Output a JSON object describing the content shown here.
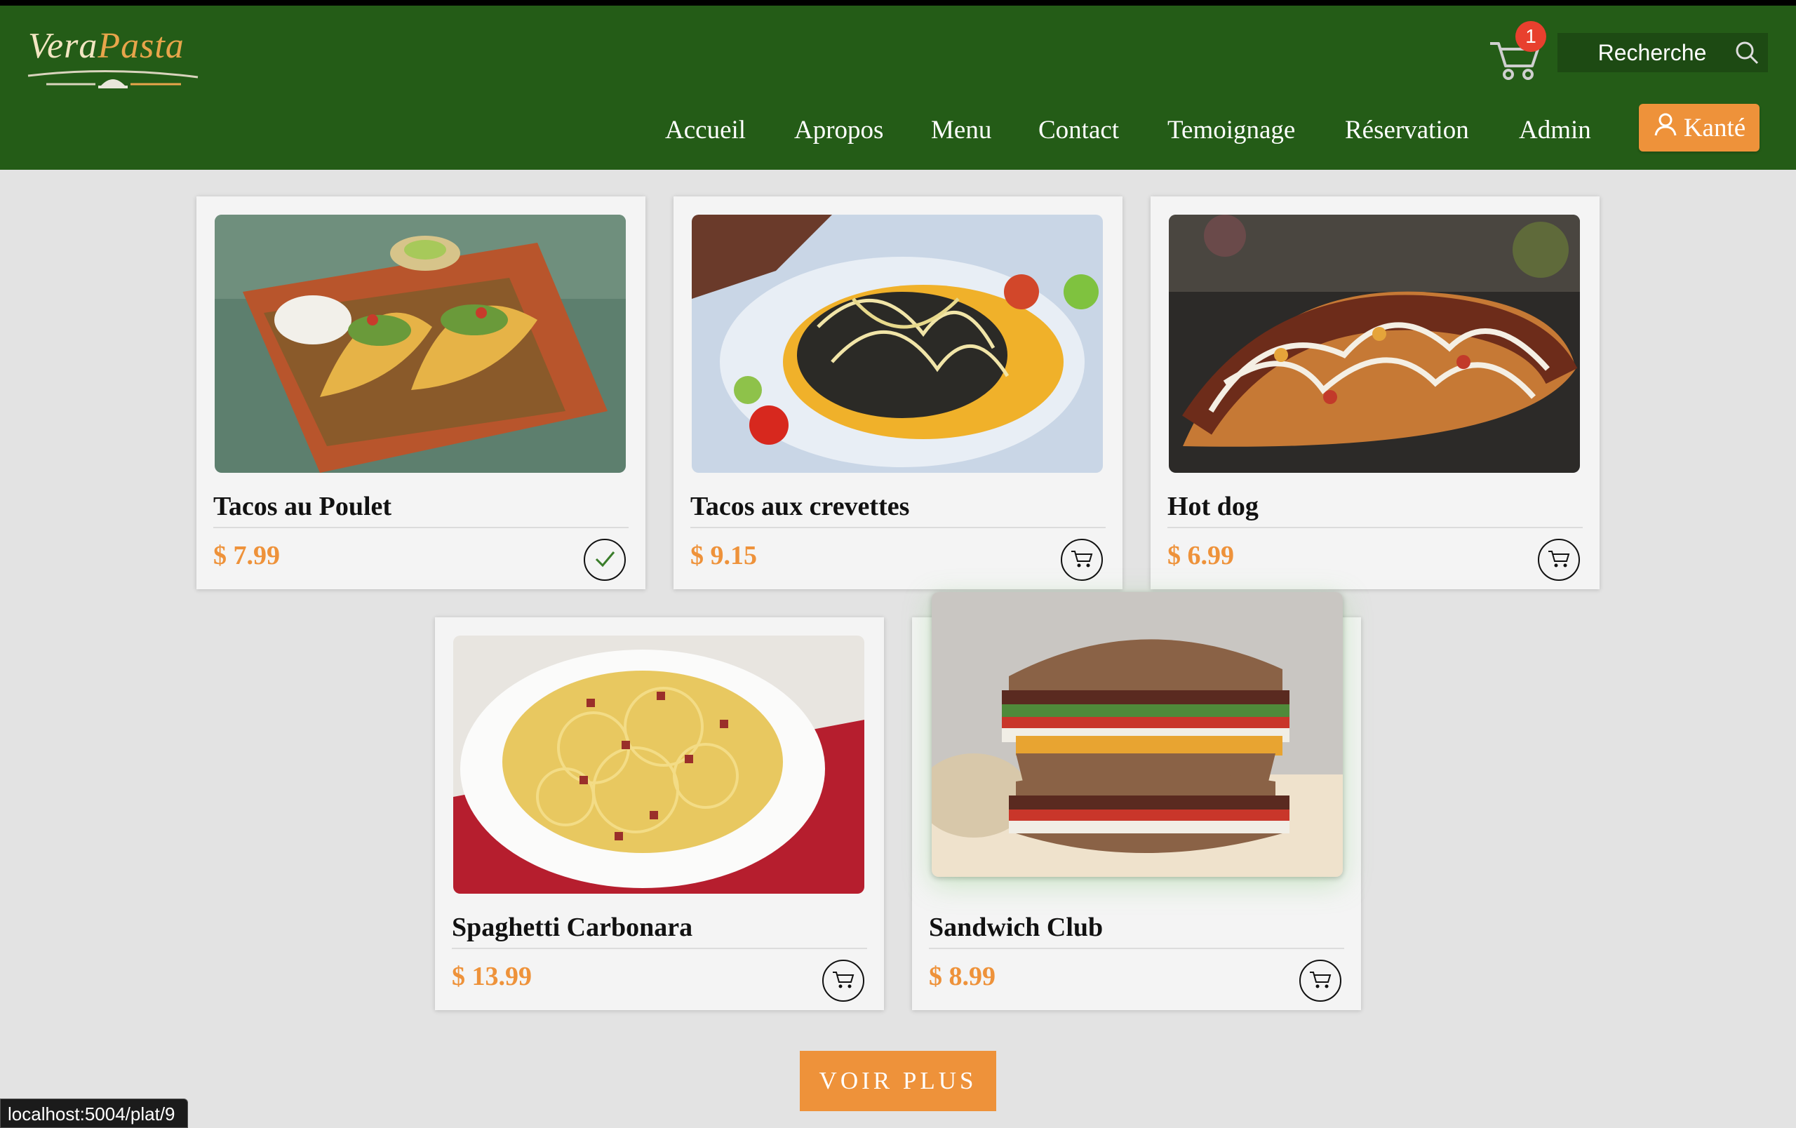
{
  "brand": {
    "logo_part1": "Vera",
    "logo_part2": "Pasta"
  },
  "header": {
    "cart_count": "1",
    "search_placeholder": "Recherche",
    "nav": [
      "Accueil",
      "Apropos",
      "Menu",
      "Contact",
      "Temoignage",
      "Réservation",
      "Admin"
    ],
    "user_label": "Kanté"
  },
  "dishes": [
    {
      "name": "Tacos au Poulet",
      "price": "$ 7.99",
      "state": "added"
    },
    {
      "name": "Tacos aux crevettes",
      "price": "$ 9.15",
      "state": "cart"
    },
    {
      "name": "Hot dog",
      "price": "$ 6.99",
      "state": "cart"
    },
    {
      "name": "Spaghetti Carbonara",
      "price": "$ 13.99",
      "state": "cart"
    },
    {
      "name": "Sandwich Club",
      "price": "$ 8.99",
      "state": "cart"
    }
  ],
  "more_button": "VOIR PLUS",
  "status_url": "localhost:5004/plat/9",
  "colors": {
    "header": "#245c17",
    "accent": "#ee923a",
    "badge": "#e8402e",
    "background": "#e3e3e3"
  }
}
